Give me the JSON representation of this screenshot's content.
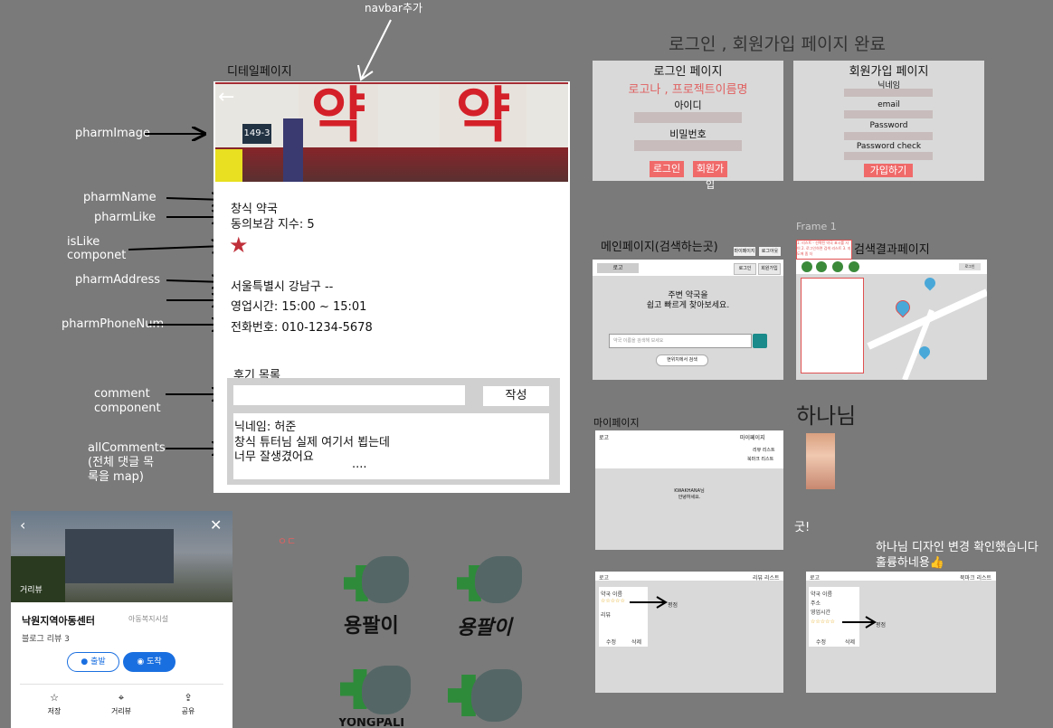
{
  "canvas": {
    "navbar_note": "navbar추가",
    "detail_title": "디테일페이지",
    "done_title": "로그인 , 회원가입 페이지 완료",
    "frame1_label": "Frame 1",
    "main_page_title": "메인페이지(검색하는곳)",
    "search_result_title": "검색결과페이지",
    "mypage_title": "마이페이지",
    "hanna": "하나님",
    "good": "굿!",
    "hanna_comment_line1": "하나님 디자인 변경 확인했습니다",
    "hanna_comment_line2": "훌륭하네용👍",
    "misc_glyph": "ㅇㄷ"
  },
  "annotations": {
    "pharmImage": "pharmImage",
    "pharmName": "pharmName",
    "pharmLike": "pharmLike",
    "isLike_line1": "isLike",
    "isLike_line2": "componet",
    "pharmAddress": "pharmAddress",
    "pharmPhoneNum": "pharmPhoneNum",
    "comment_line1": "comment",
    "comment_line2": "component",
    "allComments_line1": "allComments",
    "allComments_line2": "(전체 댓글 목",
    "allComments_line3": "록을 map)"
  },
  "detail": {
    "back_arrow": "←",
    "sign_text": "약 약",
    "sign_number": "149-3",
    "name": "창식 약국",
    "like": "동의보감 지수: 5",
    "star": "★",
    "address": "서울특별시 강남구 --",
    "hours": "영업시간: 15:00 ~ 15:01",
    "phone": "전화번호: 010-1234-5678",
    "reviews_title": "후기 목록",
    "write_button": "작성",
    "comment_nick": "닉네임: 허준",
    "comment_line1": "창식 튜터님 실제 여기서 뵙는데",
    "comment_line2": "너무 잘생겼어요",
    "comment_more": "...."
  },
  "login": {
    "title": "로그인 페이지",
    "brand": "로고나 , 프로젝트이름명",
    "id_label": "아이디",
    "pw_label": "비밀번호",
    "login_button": "로그인",
    "signup_button": "회원가입"
  },
  "signup": {
    "title": "회원가입 페이지",
    "nickname_label": "닉네임",
    "email_label": "email",
    "password_label": "Password",
    "password_check_label": "Password check",
    "submit_button": "가입하기"
  },
  "main_mock": {
    "logo": "로고",
    "mypage_btn": "마이페이지",
    "logout_btn": "로그아웃",
    "login_btn": "로그인",
    "join_btn": "회원가입",
    "headline1": "주변 약국을",
    "headline2": "쉽고 빠르게 찾아보세요.",
    "search_placeholder": "약국 이름을 검색해 보세요",
    "nearby_button": "현위치에서 검색"
  },
  "search_mock": {
    "note": "1. 리스트 - 선택된 약국 표시를 사이 2. 로그인하면 검색 리스트 3. 지도에 좀 더",
    "login_btn": "로그인"
  },
  "mypage_mock": {
    "logo": "로고",
    "mypage_link": "마이페이지",
    "review_list": "리뷰 리스트",
    "bookmark_list": "북마크 리스트",
    "greeting1": "KWAKHANA님",
    "greeting2": "안녕하세요."
  },
  "review_mock": {
    "logo": "로고",
    "header_link": "리뷰 리스트",
    "pharm_name": "약국 이름",
    "stars": "☆☆☆☆☆",
    "review": "리뷰",
    "edit": "수정",
    "delete": "삭제",
    "rating": "평점"
  },
  "bookmark_mock": {
    "logo": "로고",
    "header_link": "북마크 리스트",
    "pharm_name": "약국 이름",
    "address": "주소",
    "hours": "영업시간",
    "stars": "☆☆☆☆☆",
    "edit": "수정",
    "delete": "삭제",
    "rating": "평점"
  },
  "kakao": {
    "roadview": "거리뷰",
    "title": "낙원지역아동센터",
    "category": "아동복지시설",
    "blog_review": "블로그 리뷰 3",
    "depart": "출발",
    "arrive": "도착",
    "save": "저장",
    "roadview_action": "거리뷰",
    "share": "공유"
  },
  "logos": {
    "name_korean": "용팔이",
    "name_english": "YONGPALI"
  }
}
